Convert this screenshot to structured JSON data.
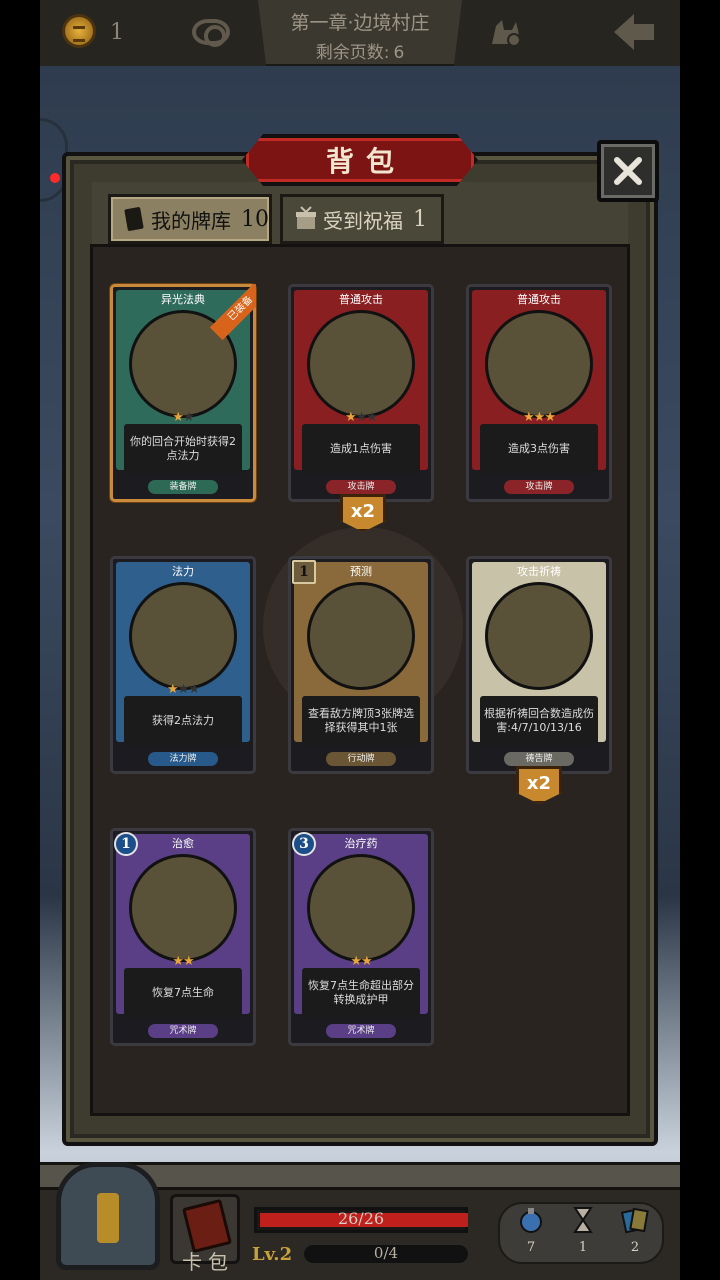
{
  "top_bar": {
    "coin_count": "1",
    "chapter_title": "第一章·边境村庄",
    "pages_label": "剩余页数:",
    "pages_value": "6"
  },
  "panel": {
    "title": "背包"
  },
  "tabs": [
    {
      "label": "我的牌库",
      "count": "10"
    },
    {
      "label": "受到祝福",
      "count": "1"
    }
  ],
  "cards": [
    {
      "name": "异光法典",
      "stars": [
        1,
        0
      ],
      "desc": "你的回合开始时获得2点法力",
      "type": "装备牌",
      "ribbon": "已装备",
      "color": "#2f6b5b"
    },
    {
      "name": "普通攻击",
      "stars": [
        1,
        0,
        0
      ],
      "desc": "造成1点伤害",
      "type": "攻击牌",
      "count": "x2",
      "color": "#8a1f22"
    },
    {
      "name": "普通攻击",
      "stars": [
        1,
        1,
        1
      ],
      "desc": "造成3点伤害",
      "type": "攻击牌",
      "color": "#8a1f22"
    },
    {
      "name": "法力",
      "stars": [
        1,
        0,
        0
      ],
      "desc": "获得2点法力",
      "type": "法力牌",
      "color": "#2f5f8c"
    },
    {
      "name": "预测",
      "stars": [],
      "desc": "查看敌方牌顶3张牌选择获得其中1张",
      "type": "行动牌",
      "cost": "1",
      "color": "#8a6a3a"
    },
    {
      "name": "攻击祈祷",
      "stars": [],
      "desc": "根据祈祷回合数造成伤害:4/7/10/13/16",
      "type": "祷告牌",
      "count": "x2",
      "color": "#c8c2a8"
    },
    {
      "name": "治愈",
      "stars": [
        1,
        1
      ],
      "desc": "恢复7点生命",
      "type": "咒术牌",
      "cost": "1",
      "color": "#5a3f86"
    },
    {
      "name": "治疗药",
      "stars": [
        1,
        1
      ],
      "desc": "恢复7点生命超出部分转换成护甲",
      "type": "咒术牌",
      "cost": "3",
      "color": "#5a3f86"
    }
  ],
  "hud": {
    "deck_label": "卡包",
    "hp_text": "26/26",
    "hp_fraction": 1.0,
    "level": "Lv.2",
    "xp_text": "0/4",
    "xp_fraction": 0.0,
    "resources": [
      {
        "icon": "potion-icon",
        "count": "7"
      },
      {
        "icon": "hourglass-icon",
        "count": "1"
      },
      {
        "icon": "cards-icon",
        "count": "2"
      }
    ]
  },
  "colors": {
    "accent_red": "#7c1414",
    "gold": "#c8892e",
    "hp": "#c0201c"
  }
}
